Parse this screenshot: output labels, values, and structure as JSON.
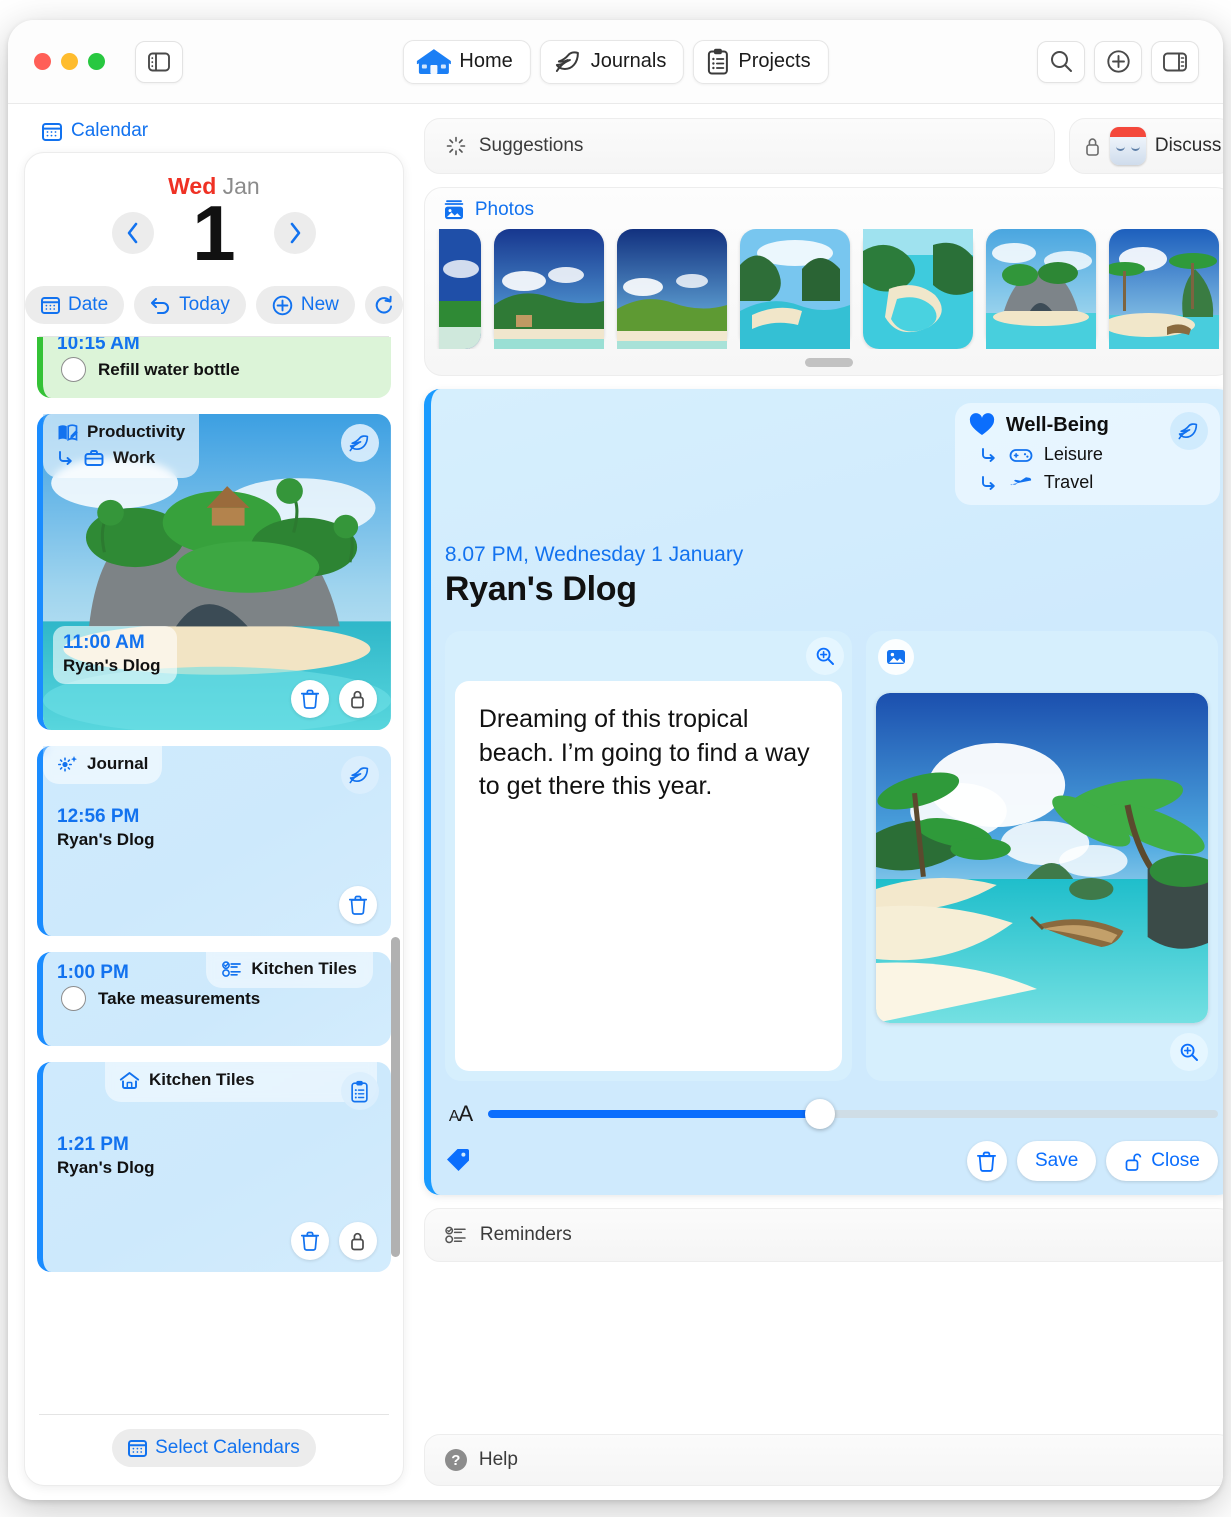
{
  "titlebar": {
    "sidebar_toggle": "sidebar-left-toggle",
    "tabs": [
      {
        "label": "Home",
        "icon": "home-icon",
        "active": true
      },
      {
        "label": "Journals",
        "icon": "leaf-icon",
        "active": false
      },
      {
        "label": "Projects",
        "icon": "clipboard-icon",
        "active": false
      }
    ],
    "right_buttons": [
      {
        "name": "search-button",
        "icon": "search-icon"
      },
      {
        "name": "add-button",
        "icon": "plus-circle-icon"
      },
      {
        "name": "inspector-toggle",
        "icon": "sidebar-right-icon"
      }
    ]
  },
  "sidebar": {
    "header": {
      "label": "Calendar",
      "icon": "calendar-icon"
    },
    "date": {
      "weekday": "Wed",
      "month": "Jan",
      "day": "1"
    },
    "nav": {
      "prev": "chevron-left-icon",
      "next": "chevron-right-icon"
    },
    "buttons": {
      "date": "Date",
      "today": "Today",
      "new": "New",
      "refresh_icon": "refresh-icon"
    },
    "events": [
      {
        "type": "task-green",
        "time": "10:15 AM",
        "task": "Refill water bottle",
        "clipped": true
      },
      {
        "type": "photo-event",
        "category": "Productivity",
        "category_icon": "book-edit-icon",
        "subcategory": "Work",
        "subcategory_icon": "briefcase-icon",
        "badge_icon": "leaf-icon",
        "time": "11:00 AM",
        "title": "Ryan's Dlog",
        "actions": [
          "trash-icon",
          "lock-icon"
        ]
      },
      {
        "type": "journal",
        "category": "Journal",
        "category_icon": "sparkle-icon",
        "badge_icon": "leaf-icon",
        "time": "12:56 PM",
        "title": "Ryan's Dlog",
        "actions": [
          "trash-icon"
        ]
      },
      {
        "type": "task-blue",
        "category": "Kitchen Tiles",
        "category_icon": "reminders-icon",
        "time": "1:00 PM",
        "task": "Take measurements"
      },
      {
        "type": "project",
        "category": "Kitchen Tiles",
        "category_icon": "house-icon",
        "badge_icon": "clipboard-icon",
        "time": "1:21 PM",
        "title": "Ryan's Dlog",
        "actions": [
          "trash-icon",
          "lock-icon"
        ]
      }
    ],
    "footer": {
      "label": "Select Calendars",
      "icon": "calendar-icon"
    }
  },
  "main": {
    "suggestions": {
      "label": "Suggestions",
      "icon": "sparkle-burst-icon"
    },
    "discuss": {
      "label": "Discuss",
      "lock_icon": "lock-icon",
      "avatar": "calendar-face-avatar"
    },
    "photos": {
      "label": "Photos",
      "icon": "photo-stack-icon",
      "count": 7,
      "scroll_handle": "horizontal-scroll-handle"
    },
    "entry": {
      "wellbeing": {
        "title": "Well-Being",
        "heart_icon": "heart-icon",
        "badge_icon": "leaf-icon",
        "rows": [
          {
            "label": "Leisure",
            "icon": "gamepad-icon",
            "arrow": "arrow-turn-icon"
          },
          {
            "label": "Travel",
            "icon": "airplane-icon",
            "arrow": "arrow-turn-icon"
          }
        ]
      },
      "timestamp": "8.07 PM, Wednesday 1 January",
      "title": "Ryan's Dlog",
      "note_text": "Dreaming of this tropical beach. I’m going to find a way to get there this year.",
      "text_zoom_icon": "zoom-in-icon",
      "image_badge_icon": "photo-icon",
      "image_zoom_icon": "zoom-in-icon",
      "font_slider": {
        "label": "AA",
        "value_percent": 45.5
      },
      "tag_icon": "tag-icon",
      "actions": {
        "delete_icon": "trash-icon",
        "save_label": "Save",
        "close_label": "Close",
        "close_icon": "unlock-icon"
      }
    },
    "reminders": {
      "label": "Reminders",
      "icon": "reminders-icon"
    },
    "help": {
      "label": "Help",
      "icon": "question-icon"
    }
  },
  "colors": {
    "accent_blue": "#0b6efd",
    "link_blue": "#1272ef",
    "bright_blue": "#1a9bff",
    "entry_bg": "#cfeafd",
    "task_green": "#dcf4d8",
    "red": "#ef3124"
  }
}
